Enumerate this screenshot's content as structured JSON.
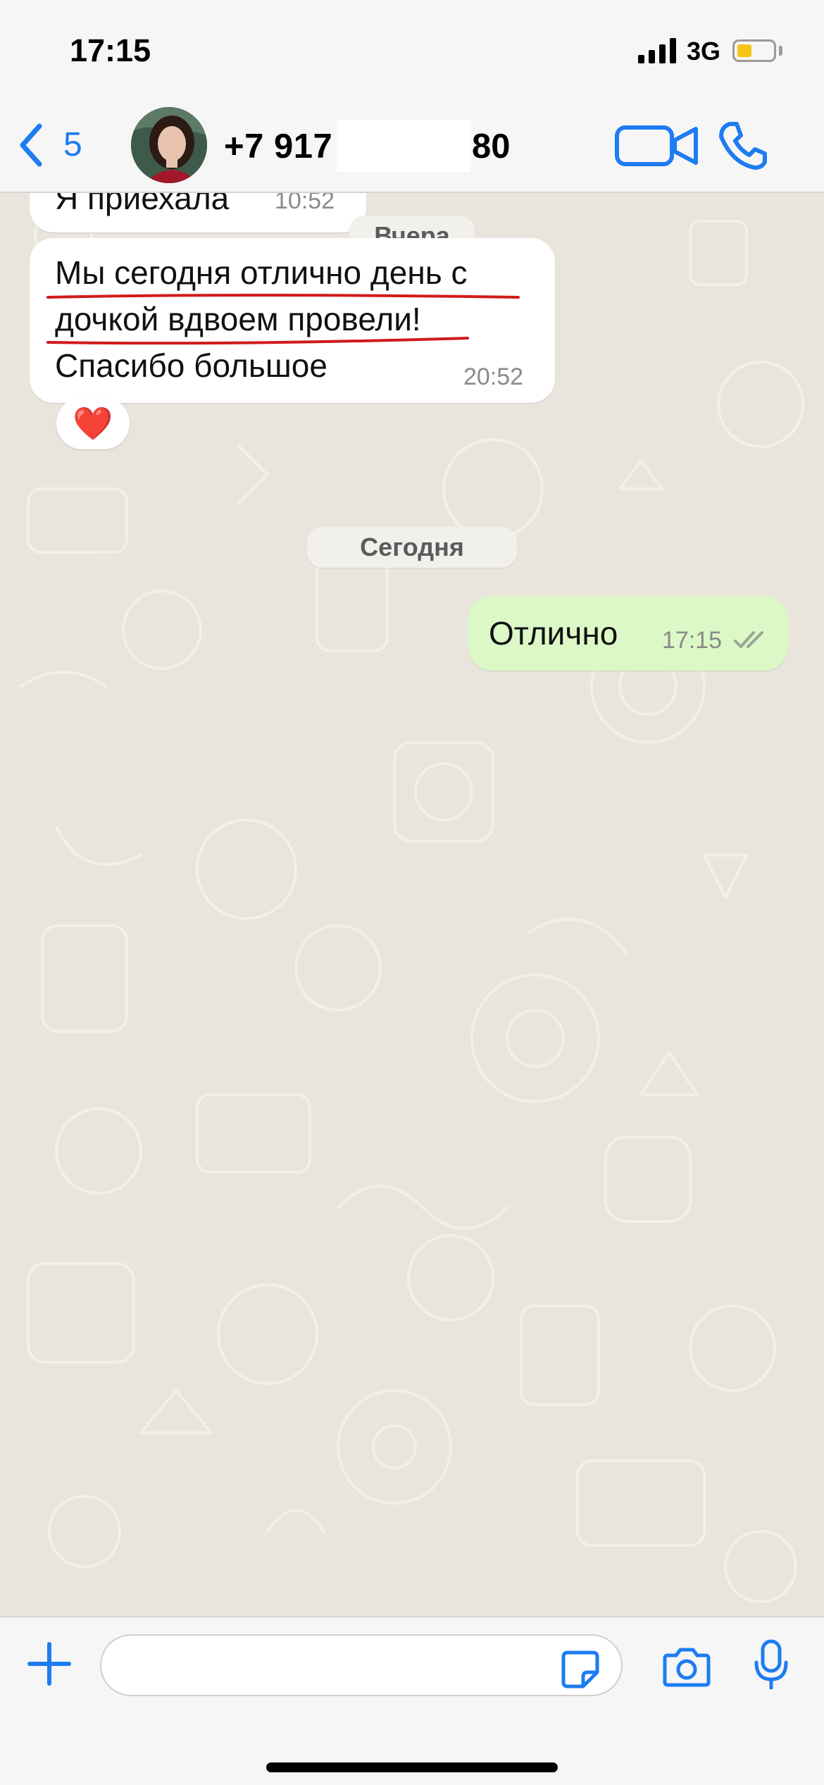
{
  "status_bar": {
    "time": "17:15",
    "network": "3G",
    "battery_level": 0.35
  },
  "header": {
    "back_count": "5",
    "contact_prefix": "+7 917",
    "contact_suffix": "80",
    "icons": [
      "chevron-left-icon",
      "avatar",
      "video-icon",
      "phone-icon"
    ],
    "accent_color": "#1d7cf2"
  },
  "messages": [
    {
      "direction": "in",
      "text": "Я приехала",
      "time": "10:52"
    },
    {
      "date_chip": "Вчера"
    },
    {
      "direction": "in",
      "lines": [
        "Мы сегодня отлично день с",
        "дочкой вдвоем провели!",
        "Спасибо большое"
      ],
      "time": "20:52",
      "reaction": "❤️"
    },
    {
      "date_chip": "Сегодня"
    },
    {
      "direction": "out",
      "text": "Отлично",
      "time": "17:15",
      "status": "read"
    }
  ],
  "input_bar": {
    "placeholder": "",
    "icons": [
      "plus-icon",
      "sticker-icon",
      "camera-icon",
      "microphone-icon"
    ]
  },
  "colors": {
    "incoming_bubble": "#ffffff",
    "outgoing_bubble": "#dcf8c6",
    "wallpaper": "#e9e5dd",
    "underline": "#d11a1a"
  }
}
